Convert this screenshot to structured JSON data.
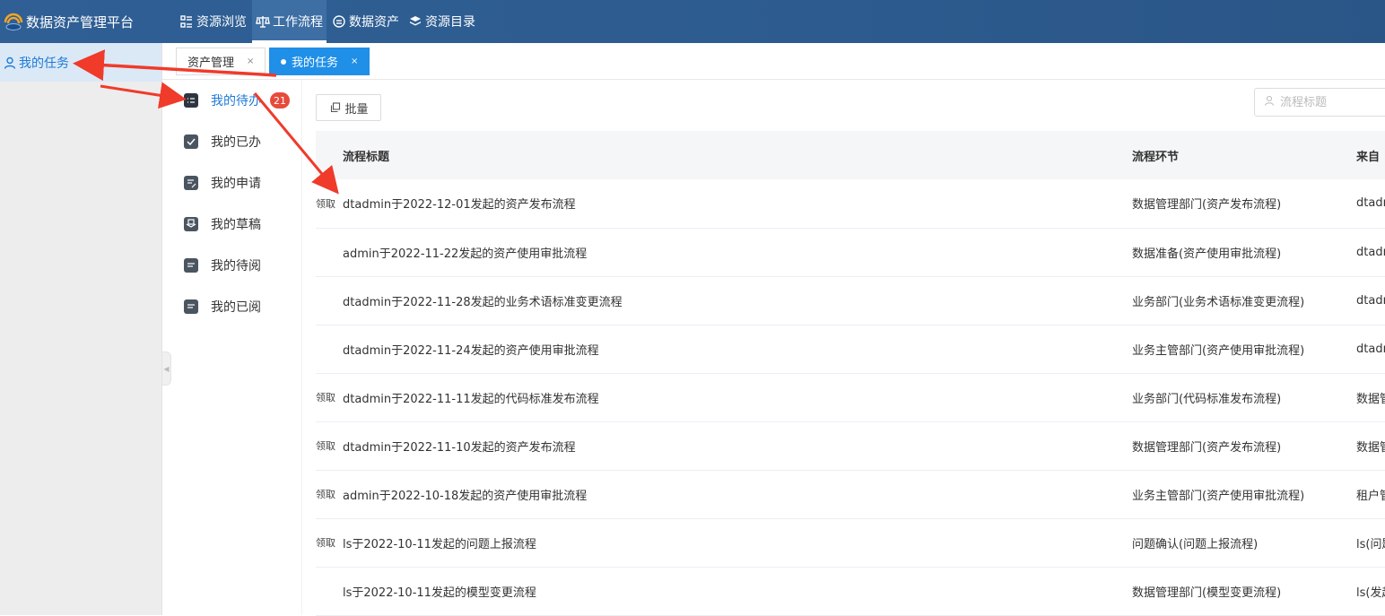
{
  "app": {
    "title": "数据资产管理平台"
  },
  "nav": [
    {
      "label": "资源浏览",
      "icon": "grid-list-icon",
      "active": false
    },
    {
      "label": "工作流程",
      "icon": "workflow-icon",
      "active": true
    },
    {
      "label": "数据资产",
      "icon": "asset-icon",
      "active": false
    },
    {
      "label": "资源目录",
      "icon": "layers-icon",
      "active": false
    }
  ],
  "sidebar": {
    "items": [
      {
        "label": "我的任务",
        "icon": "user-icon",
        "active": true
      }
    ]
  },
  "tabs": [
    {
      "label": "资产管理",
      "close": "×",
      "active": false
    },
    {
      "label": "我的任务",
      "close": "×",
      "active": true
    }
  ],
  "submenu": {
    "items": [
      {
        "label": "我的待办",
        "icon": "todo-icon",
        "active": true,
        "badge": "21"
      },
      {
        "label": "我的已办",
        "icon": "done-icon",
        "active": false
      },
      {
        "label": "我的申请",
        "icon": "apply-icon",
        "active": false
      },
      {
        "label": "我的草稿",
        "icon": "draft-icon",
        "active": false
      },
      {
        "label": "我的待阅",
        "icon": "unread-icon",
        "active": false
      },
      {
        "label": "我的已阅",
        "icon": "read-icon",
        "active": false
      }
    ]
  },
  "toolbar": {
    "batch_label": "批量"
  },
  "search": {
    "placeholder": "流程标题"
  },
  "table": {
    "headers": {
      "title": "流程标题",
      "node": "流程环节",
      "from": "来自"
    },
    "rows": [
      {
        "claim": "领取",
        "title": "dtadmin于2022-12-01发起的资产发布流程",
        "node": "数据管理部门(资产发布流程)",
        "from": "dtadm"
      },
      {
        "claim": "",
        "title": "admin于2022-11-22发起的资产使用审批流程",
        "node": "数据准备(资产使用审批流程)",
        "from": "dtadm"
      },
      {
        "claim": "",
        "title": "dtadmin于2022-11-28发起的业务术语标准变更流程",
        "node": "业务部门(业务术语标准变更流程)",
        "from": "dtadm"
      },
      {
        "claim": "",
        "title": "dtadmin于2022-11-24发起的资产使用审批流程",
        "node": "业务主管部门(资产使用审批流程)",
        "from": "dtadm"
      },
      {
        "claim": "领取",
        "title": "dtadmin于2022-11-11发起的代码标准发布流程",
        "node": "业务部门(代码标准发布流程)",
        "from": "数据管"
      },
      {
        "claim": "领取",
        "title": "dtadmin于2022-11-10发起的资产发布流程",
        "node": "数据管理部门(资产发布流程)",
        "from": "数据管"
      },
      {
        "claim": "领取",
        "title": "admin于2022-10-18发起的资产使用审批流程",
        "node": "业务主管部门(资产使用审批流程)",
        "from": "租户管"
      },
      {
        "claim": "领取",
        "title": "ls于2022-10-11发起的问题上报流程",
        "node": "问题确认(问题上报流程)",
        "from": "ls(问题"
      },
      {
        "claim": "",
        "title": "ls于2022-10-11发起的模型变更流程",
        "node": "数据管理部门(模型变更流程)",
        "from": "ls(发起"
      }
    ]
  },
  "colors": {
    "accent": "#1e7ad6",
    "tab_active": "#1f8fe8",
    "topbar": "#2d5b8f",
    "badge": "#e74b3c",
    "annotation": "#f03a2a"
  }
}
